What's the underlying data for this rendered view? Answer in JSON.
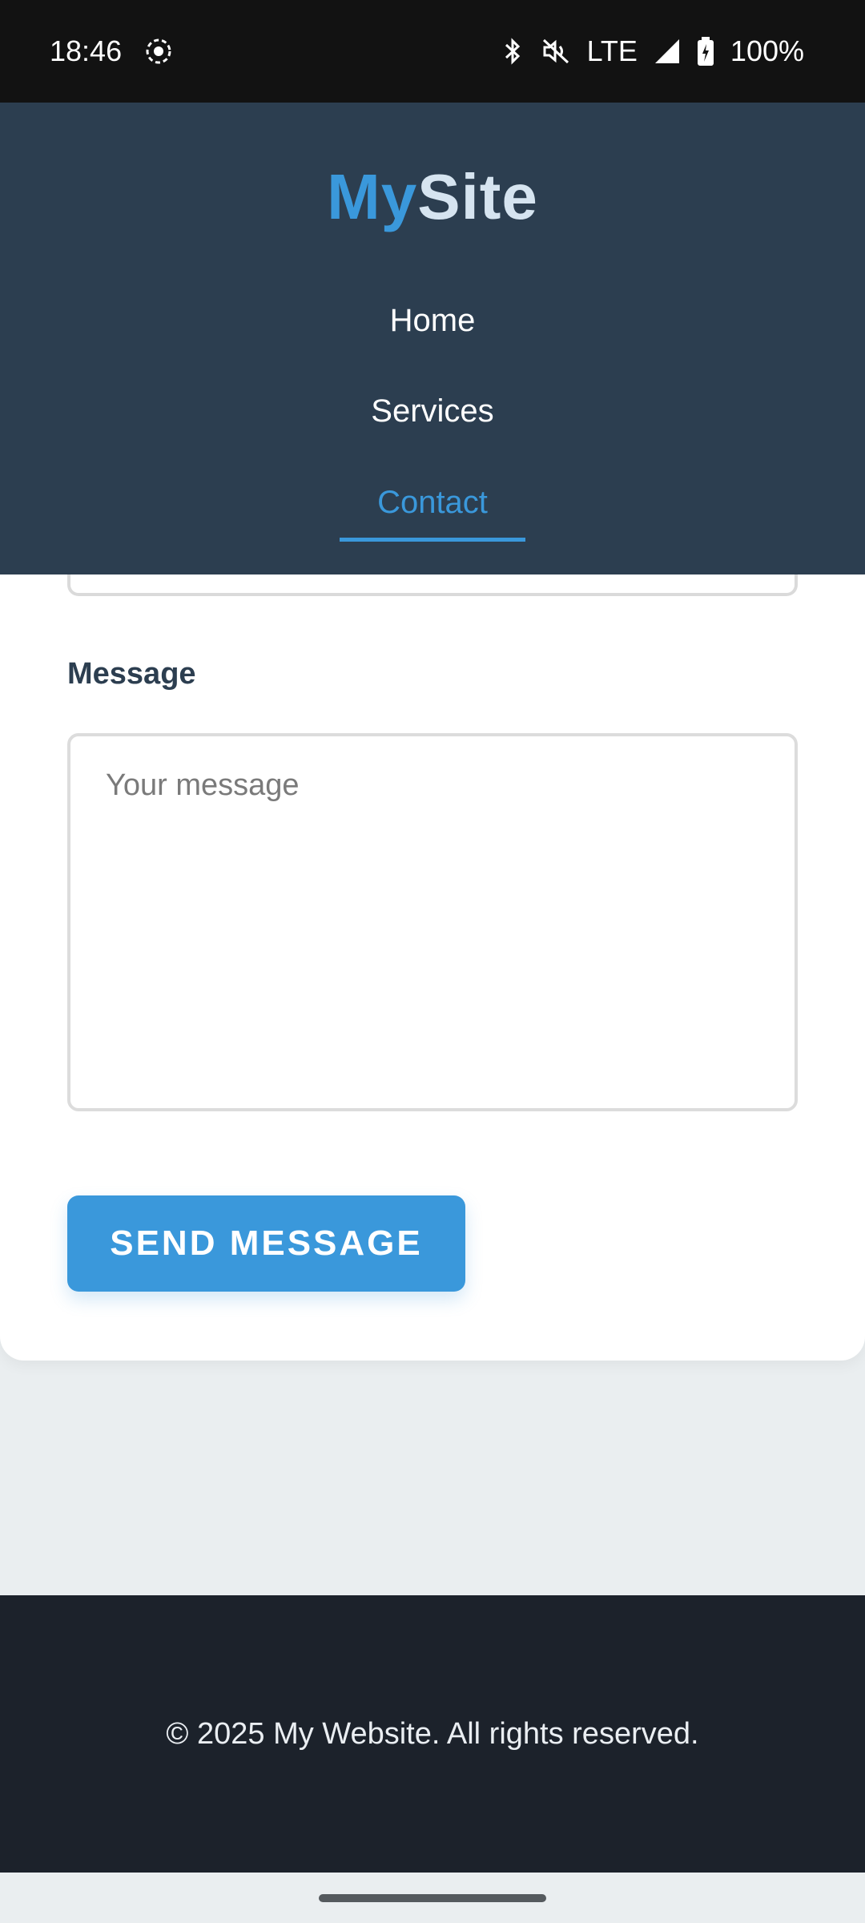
{
  "status_bar": {
    "time": "18:46",
    "network": "LTE",
    "battery": "100%",
    "icons": [
      "screen-record-icon",
      "bluetooth-icon",
      "mute-icon",
      "signal-icon",
      "battery-charging-icon"
    ]
  },
  "header": {
    "logo_part1": "My",
    "logo_part2": "Site",
    "nav": {
      "home": "Home",
      "services": "Services",
      "contact": "Contact"
    },
    "active_nav": "contact"
  },
  "form": {
    "message_label": "Message",
    "message_placeholder": "Your message",
    "message_value": "",
    "send_label": "SEND MESSAGE"
  },
  "footer": {
    "copyright": "© 2025 My Website. All rights reserved."
  },
  "colors": {
    "accent": "#3a98db",
    "header_bg": "#2c3e50",
    "footer_bg": "#1c222b",
    "page_bg": "#eaeef0"
  }
}
